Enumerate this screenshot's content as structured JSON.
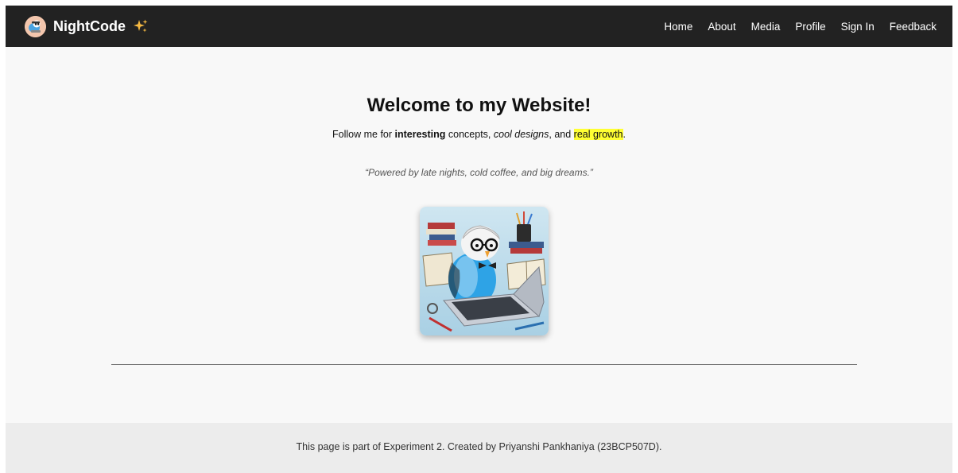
{
  "brand": {
    "name": "NightCode",
    "logo_icon": "bird-logo-icon",
    "sparkle_icon": "sparkles-icon",
    "sparkle_color": "#f5b942"
  },
  "nav": {
    "links": [
      "Home",
      "About",
      "Media",
      "Profile",
      "Sign In",
      "Feedback"
    ]
  },
  "hero": {
    "title": "Welcome to my Website!",
    "intro": {
      "prefix": "Follow me for ",
      "bold": "interesting",
      "middle": " concepts, ",
      "italic": "cool designs",
      "and": ", and ",
      "highlight": "real growth",
      "suffix": "."
    },
    "quote": "“Powered by late nights, cold coffee, and big dreams.”",
    "image_icon": "budgie-coder-illustration"
  },
  "footer": {
    "text": "This page is part of Experiment 2. Created by Priyanshi Pankhaniya (23BCP507D)."
  },
  "colors": {
    "navbar": "#222222",
    "page_background": "#f8f8f8",
    "footer_background": "#ececec",
    "highlight": "#ffff33"
  }
}
